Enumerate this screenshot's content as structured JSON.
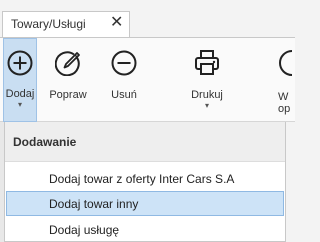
{
  "tab": {
    "label": "Towary/Usługi",
    "close_glyph": "✕"
  },
  "ribbon": {
    "buttons": [
      {
        "label": "Dodaj",
        "icon": "plus-circle-icon",
        "has_dropdown": true,
        "active": true
      },
      {
        "label": "Popraw",
        "icon": "pencil-circle-icon"
      },
      {
        "label": "Usuń",
        "icon": "minus-circle-icon"
      },
      {
        "label": "Drukuj",
        "icon": "printer-icon",
        "has_dropdown": true
      },
      {
        "label": "W\nop",
        "icon": "partial-circle-icon"
      }
    ],
    "caret": "▾"
  },
  "menu": {
    "header": "Dodawanie",
    "items": [
      {
        "label": "Dodaj towar z oferty Inter Cars S.A"
      },
      {
        "label": "Dodaj towar inny",
        "highlighted": true
      },
      {
        "label": "Dodaj usługę"
      }
    ]
  },
  "colors": {
    "active_button_bg": "#c9def2",
    "highlight_bg": "#cde3f7",
    "icon_stroke": "#222222"
  }
}
